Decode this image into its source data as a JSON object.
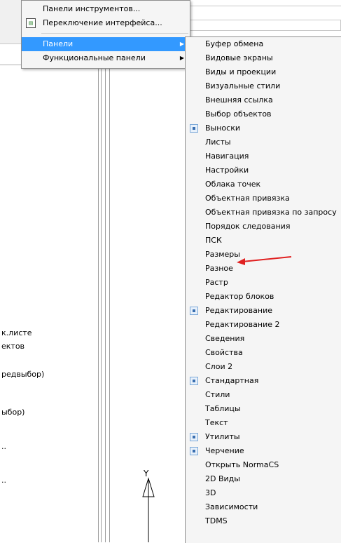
{
  "menu": {
    "items": [
      {
        "label": "Панели инструментов...",
        "has_submenu": false,
        "icon": ""
      },
      {
        "label": "Переключение интерфейса...",
        "has_submenu": false,
        "icon": "interface-switch-icon"
      },
      {
        "label": "Панели",
        "has_submenu": true,
        "selected": true,
        "icon": ""
      },
      {
        "label": "Функциональные панели",
        "has_submenu": true,
        "icon": ""
      }
    ]
  },
  "submenu": {
    "items": [
      {
        "label": "Буфер обмена",
        "checked": false
      },
      {
        "label": "Видовые экраны",
        "checked": false
      },
      {
        "label": "Виды и проекции",
        "checked": false
      },
      {
        "label": "Визуальные стили",
        "checked": false
      },
      {
        "label": "Внешняя ссылка",
        "checked": false
      },
      {
        "label": "Выбор объектов",
        "checked": false
      },
      {
        "label": "Выноски",
        "checked": true
      },
      {
        "label": "Листы",
        "checked": false
      },
      {
        "label": "Навигация",
        "checked": false
      },
      {
        "label": "Настройки",
        "checked": false
      },
      {
        "label": "Облака точек",
        "checked": false
      },
      {
        "label": "Объектная привязка",
        "checked": false
      },
      {
        "label": "Объектная привязка по запросу",
        "checked": false
      },
      {
        "label": "Порядок следования",
        "checked": false
      },
      {
        "label": "ПСК",
        "checked": false
      },
      {
        "label": "Размеры",
        "checked": false
      },
      {
        "label": "Разное",
        "checked": false
      },
      {
        "label": "Растр",
        "checked": false
      },
      {
        "label": "Редактор блоков",
        "checked": false
      },
      {
        "label": "Редактирование",
        "checked": true
      },
      {
        "label": "Редактирование 2",
        "checked": false
      },
      {
        "label": "Сведения",
        "checked": false
      },
      {
        "label": "Свойства",
        "checked": false
      },
      {
        "label": "Слои 2",
        "checked": false
      },
      {
        "label": "Стандартная",
        "checked": true
      },
      {
        "label": "Стили",
        "checked": false
      },
      {
        "label": "Таблицы",
        "checked": false
      },
      {
        "label": "Текст",
        "checked": false
      },
      {
        "label": "Утилиты",
        "checked": true
      },
      {
        "label": "Черчение",
        "checked": true
      },
      {
        "label": "Открыть NormaCS",
        "checked": false
      },
      {
        "label": "2D Виды",
        "checked": false
      },
      {
        "label": "3D",
        "checked": false
      },
      {
        "label": "Зависимости",
        "checked": false
      },
      {
        "label": "TDMS",
        "checked": false
      }
    ]
  },
  "left_panel": {
    "lines": [
      "к.листе",
      "ектов",
      "редвыбор)",
      "ыбор)",
      "..",
      ".."
    ]
  },
  "canvas": {
    "ucs_label": "Y"
  },
  "annotation": {
    "color": "#e02020"
  }
}
